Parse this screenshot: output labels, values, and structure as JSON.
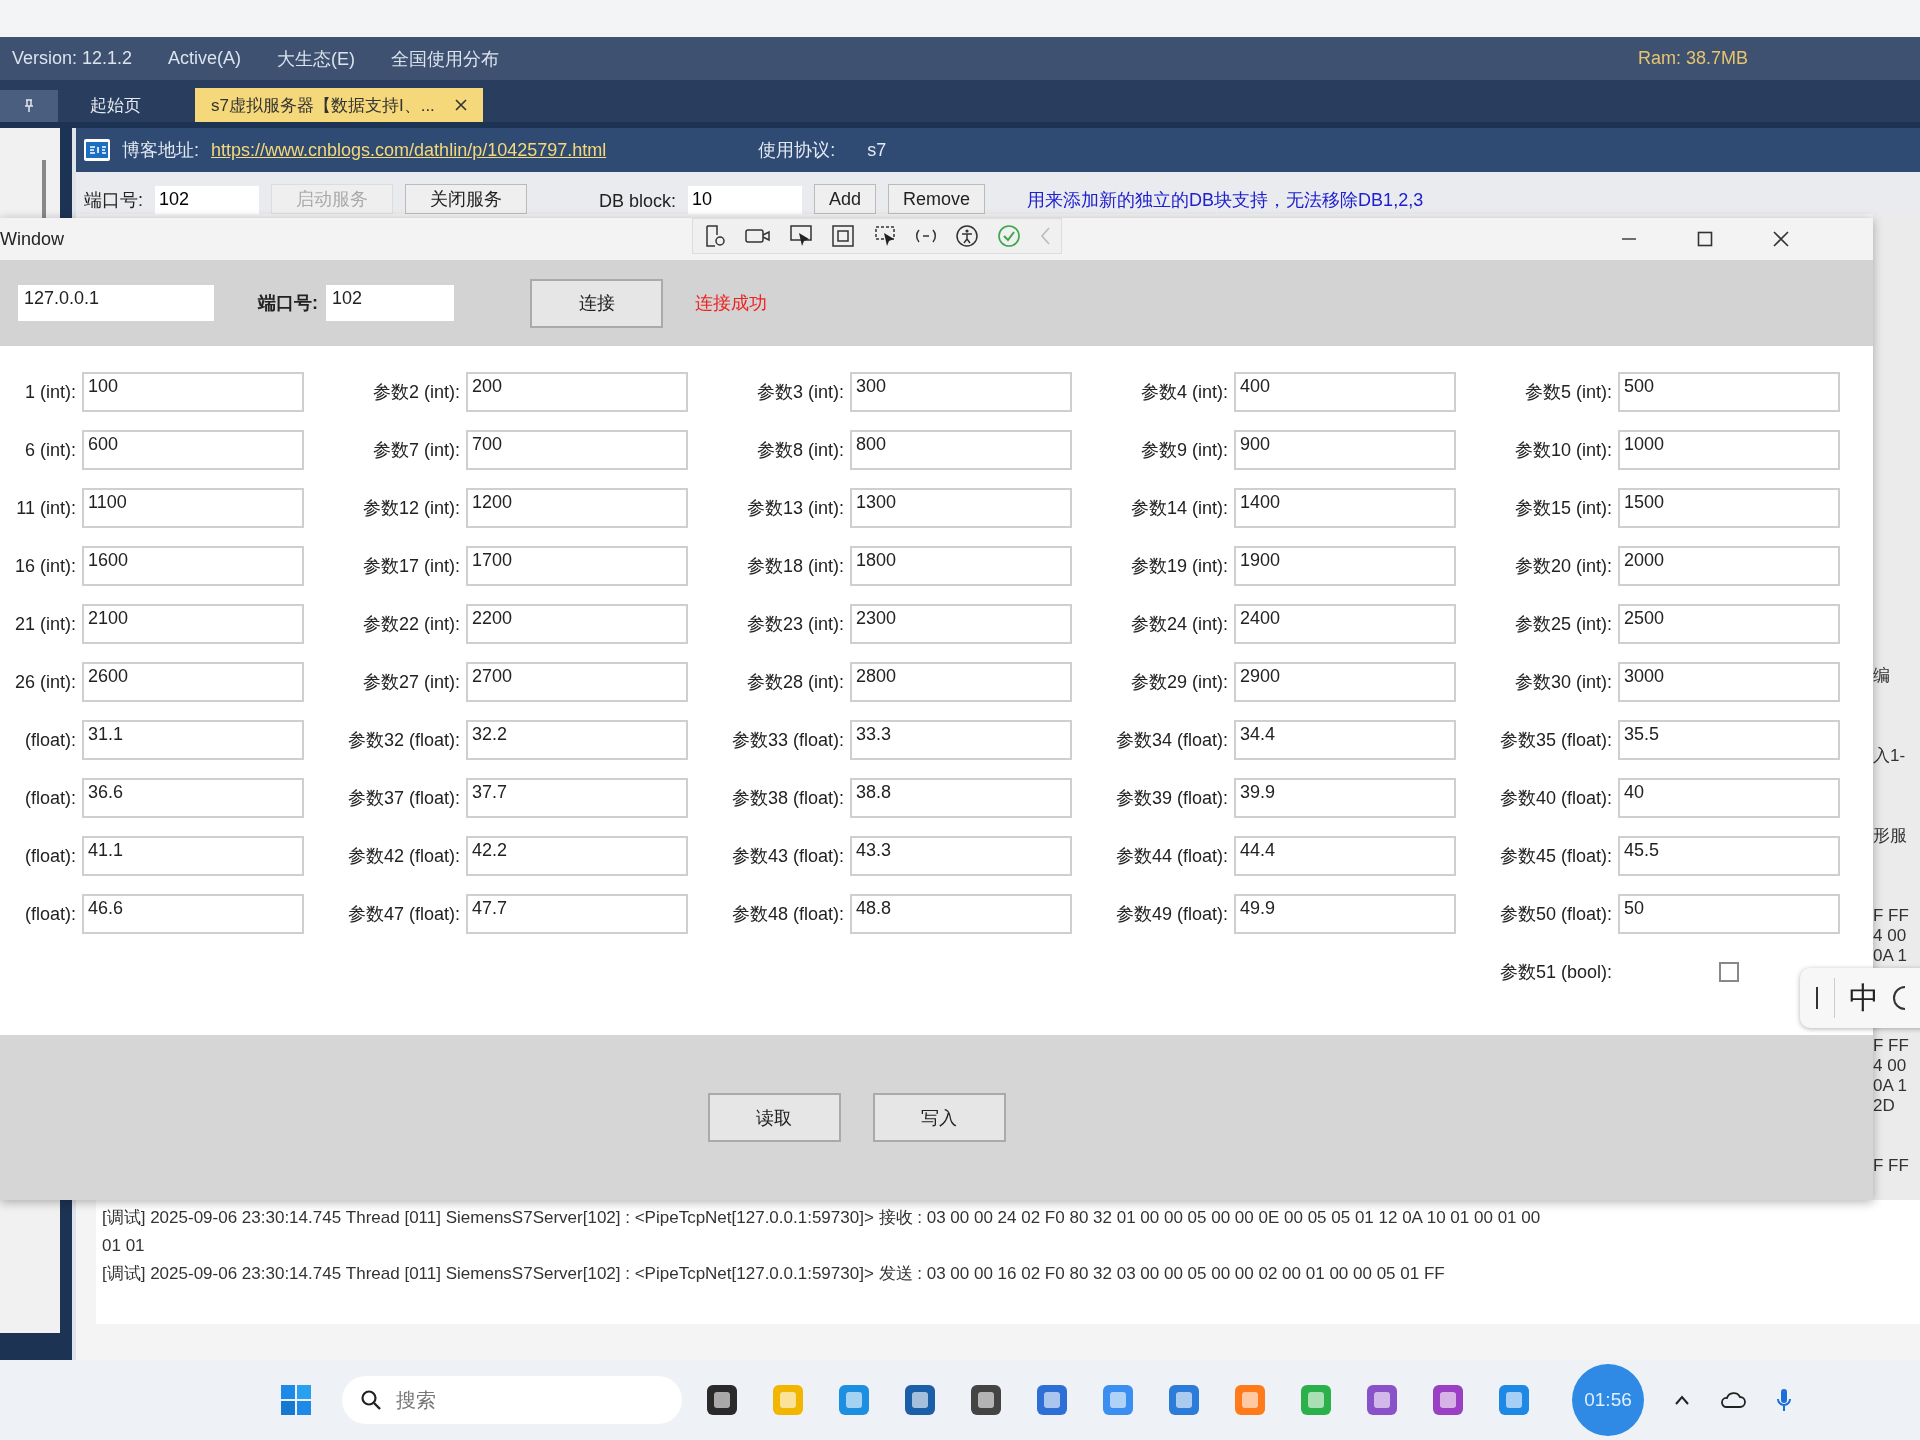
{
  "menubar": {
    "version": "Version: 12.1.2",
    "items": [
      "Active(A)",
      "大生态(E)",
      "全国使用分布"
    ],
    "ram": "Ram: 38.7MB"
  },
  "tabs": [
    {
      "label": "起始页",
      "selected": false,
      "closable": false
    },
    {
      "label": "s7虚拟服务器【数据支持I、...",
      "selected": true,
      "closable": true
    }
  ],
  "blog": {
    "label": "博客地址:",
    "link": "https://www.cnblogs.com/dathlin/p/10425797.html",
    "protocol_label": "使用协议:",
    "protocol": "s7"
  },
  "server_bar": {
    "port_label": "端口号:",
    "port": "102",
    "start": "启动服务",
    "start_disabled": true,
    "stop": "关闭服务",
    "db_label": "DB block:",
    "db": "10",
    "add": "Add",
    "remove": "Remove",
    "note": "用来添加新的独立的DB块支持，无法移除DB1,2,3"
  },
  "side_fragments": [
    {
      "text": "编",
      "kind": "label"
    },
    {
      "text": "入1-",
      "kind": "label"
    },
    {
      "text": "形服",
      "kind": "label"
    },
    {
      "text": "F FF",
      "kind": "hex"
    },
    {
      "text": "4 00",
      "kind": "hex"
    },
    {
      "text": "0A 1",
      "kind": "hex"
    },
    {
      "text": "F FF",
      "kind": "hex"
    },
    {
      "text": "4 00",
      "kind": "hex"
    },
    {
      "text": "0A 1",
      "kind": "hex"
    },
    {
      "text": "2D",
      "kind": "hex"
    },
    {
      "text": "F FF",
      "kind": "hex"
    }
  ],
  "dialog": {
    "title": "Window",
    "ip": "127.0.0.1",
    "port_label": "端口号:",
    "port": "102",
    "connect": "连接",
    "status": "连接成功",
    "params": [
      {
        "label": "1 (int):",
        "value": "100",
        "kind": "field"
      },
      {
        "label": "参数2 (int):",
        "value": "200",
        "kind": "field"
      },
      {
        "label": "参数3 (int):",
        "value": "300",
        "kind": "field"
      },
      {
        "label": "参数4 (int):",
        "value": "400",
        "kind": "field"
      },
      {
        "label": "参数5 (int):",
        "value": "500",
        "kind": "field"
      },
      {
        "label": "6 (int):",
        "value": "600",
        "kind": "field"
      },
      {
        "label": "参数7 (int):",
        "value": "700",
        "kind": "field"
      },
      {
        "label": "参数8 (int):",
        "value": "800",
        "kind": "field"
      },
      {
        "label": "参数9 (int):",
        "value": "900",
        "kind": "field"
      },
      {
        "label": "参数10 (int):",
        "value": "1000",
        "kind": "field"
      },
      {
        "label": "11 (int):",
        "value": "1100",
        "kind": "field"
      },
      {
        "label": "参数12 (int):",
        "value": "1200",
        "kind": "field"
      },
      {
        "label": "参数13 (int):",
        "value": "1300",
        "kind": "field"
      },
      {
        "label": "参数14 (int):",
        "value": "1400",
        "kind": "field"
      },
      {
        "label": "参数15 (int):",
        "value": "1500",
        "kind": "field"
      },
      {
        "label": "16 (int):",
        "value": "1600",
        "kind": "field"
      },
      {
        "label": "参数17 (int):",
        "value": "1700",
        "kind": "field"
      },
      {
        "label": "参数18 (int):",
        "value": "1800",
        "kind": "field"
      },
      {
        "label": "参数19 (int):",
        "value": "1900",
        "kind": "field"
      },
      {
        "label": "参数20 (int):",
        "value": "2000",
        "kind": "field"
      },
      {
        "label": "21 (int):",
        "value": "2100",
        "kind": "field"
      },
      {
        "label": "参数22 (int):",
        "value": "2200",
        "kind": "field"
      },
      {
        "label": "参数23 (int):",
        "value": "2300",
        "kind": "field"
      },
      {
        "label": "参数24 (int):",
        "value": "2400",
        "kind": "field"
      },
      {
        "label": "参数25 (int):",
        "value": "2500",
        "kind": "field"
      },
      {
        "label": "26 (int):",
        "value": "2600",
        "kind": "field"
      },
      {
        "label": "参数27 (int):",
        "value": "2700",
        "kind": "field"
      },
      {
        "label": "参数28 (int):",
        "value": "2800",
        "kind": "field"
      },
      {
        "label": "参数29 (int):",
        "value": "2900",
        "kind": "field"
      },
      {
        "label": "参数30 (int):",
        "value": "3000",
        "kind": "field"
      },
      {
        "label": "(float):",
        "value": "31.1",
        "kind": "field"
      },
      {
        "label": "参数32 (float):",
        "value": "32.2",
        "kind": "field"
      },
      {
        "label": "参数33 (float):",
        "value": "33.3",
        "kind": "field"
      },
      {
        "label": "参数34 (float):",
        "value": "34.4",
        "kind": "field"
      },
      {
        "label": "参数35 (float):",
        "value": "35.5",
        "kind": "field"
      },
      {
        "label": "(float):",
        "value": "36.6",
        "kind": "field"
      },
      {
        "label": "参数37 (float):",
        "value": "37.7",
        "kind": "field"
      },
      {
        "label": "参数38 (float):",
        "value": "38.8",
        "kind": "field"
      },
      {
        "label": "参数39 (float):",
        "value": "39.9",
        "kind": "field"
      },
      {
        "label": "参数40 (float):",
        "value": "40",
        "kind": "field"
      },
      {
        "label": "(float):",
        "value": "41.1",
        "kind": "field"
      },
      {
        "label": "参数42 (float):",
        "value": "42.2",
        "kind": "field"
      },
      {
        "label": "参数43 (float):",
        "value": "43.3",
        "kind": "field"
      },
      {
        "label": "参数44 (float):",
        "value": "44.4",
        "kind": "field"
      },
      {
        "label": "参数45 (float):",
        "value": "45.5",
        "kind": "field"
      },
      {
        "label": "(float):",
        "value": "46.6",
        "kind": "field"
      },
      {
        "label": "参数47 (float):",
        "value": "47.7",
        "kind": "field"
      },
      {
        "label": "参数48 (float):",
        "value": "48.8",
        "kind": "field"
      },
      {
        "label": "参数49 (float):",
        "value": "49.9",
        "kind": "field"
      },
      {
        "label": "参数50 (float):",
        "value": "50",
        "kind": "field"
      },
      {
        "label": "参数51 (bool):",
        "kind": "checkbox",
        "checked": false
      }
    ],
    "buttons": [
      "读取",
      "写入"
    ]
  },
  "ime": {
    "mode": "中"
  },
  "log": [
    "[调试] 2025-09-06 23:30:14.745 Thread [011] SiemensS7Server[102] : <PipeTcpNet[127.0.0.1:59730]> 接收 : 03 00 00 24 02 F0 80 32 01 00 00 05 00 00 0E 00 05 05 01 12 0A 10 01 00 01 00",
    "01 01",
    "[调试] 2025-09-06 23:30:14.745 Thread [011] SiemensS7Server[102] : <PipeTcpNet[127.0.0.1:59730]> 发送 : 03 00 00 16 02 F0 80 32 03 00 00 05 00 00 02 00 01 00 00 05 01 FF"
  ],
  "taskbar": {
    "search_placeholder": "搜索",
    "clock": "01:56"
  }
}
